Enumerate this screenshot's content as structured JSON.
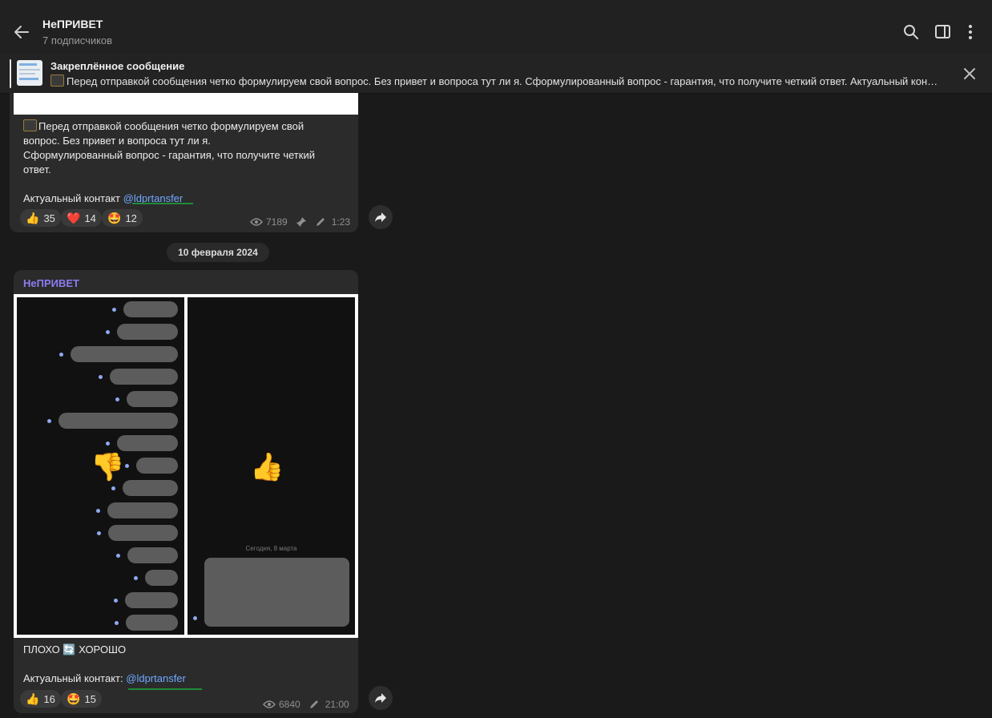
{
  "header": {
    "channel_name": "НеПРИВЕТ",
    "subscribers": "7 подписчиков",
    "icons": [
      "back-arrow-icon",
      "search-icon",
      "sidebar-toggle-icon",
      "more-vertical-icon"
    ]
  },
  "pinned": {
    "title": "Закреплённое сообщение",
    "text": "Перед отправкой сообщения четко формулируем свой вопрос. Без привет и вопроса тут ли я.  Сформулированный вопрос - гарантия, что получите четкий ответ.  Актуальный контакт @ldprtansfer",
    "icons": [
      "pinned-thumbnail",
      "close-icon"
    ]
  },
  "message1": {
    "lines": [
      "Перед отправкой сообщения четко формулируем свой",
      "вопрос. Без привет и вопроса тут ли я.",
      "Сформулированный вопрос - гарантия, что получите четкий",
      "ответ."
    ],
    "contact_prefix": "Актуальный контакт ",
    "contact_link": "@ldprtansfer",
    "reactions": [
      {
        "emoji": "👍",
        "count": "35"
      },
      {
        "emoji": "❤️",
        "count": "14"
      },
      {
        "emoji": "🤩",
        "count": "12"
      }
    ],
    "views": "7189",
    "time": "1:23",
    "meta_icons": [
      "eye-icon",
      "pin-icon",
      "edit-icon"
    ]
  },
  "date_divider": "10 февраля 2024",
  "message2": {
    "author": "НеПРИВЕТ",
    "image": {
      "left_emoji": "👎",
      "right_emoji": "👍",
      "right_date": "Сегодня, 8 марта"
    },
    "caption_left": "ПЛОХО",
    "caption_emoji": "🔄",
    "caption_right": "ХОРОШО",
    "contact_prefix": "Актуальный контакт: ",
    "contact_link": "@ldprtansfer",
    "reactions": [
      {
        "emoji": "👍",
        "count": "16"
      },
      {
        "emoji": "🤩",
        "count": "15"
      }
    ],
    "views": "6840",
    "time": "21:00"
  },
  "colors": {
    "background": "#1a1a1a",
    "header": "#212121",
    "bubble": "#2b2b2b",
    "link": "#6fa8ff",
    "author": "#8b7cf0"
  }
}
